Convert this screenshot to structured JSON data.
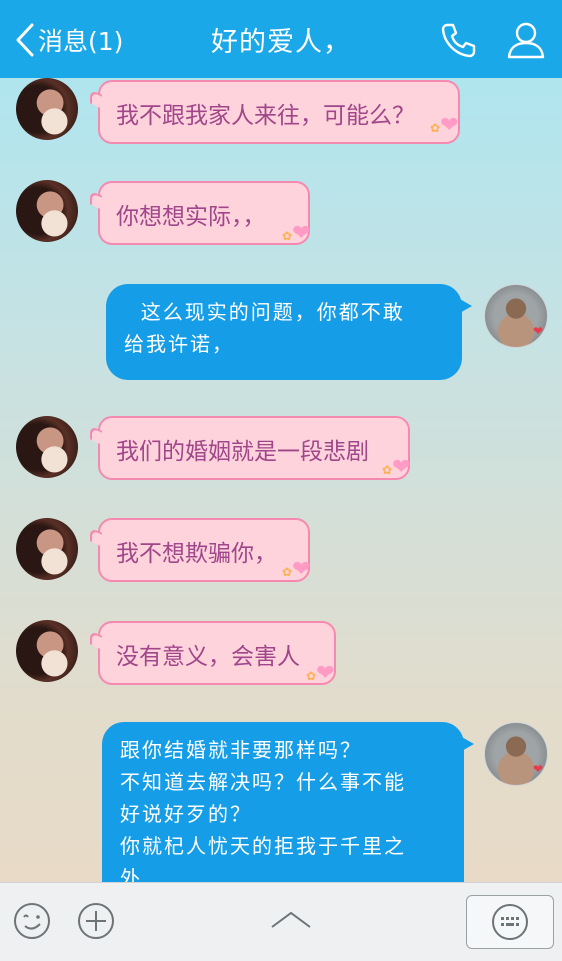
{
  "header": {
    "back_label": "消息(1)",
    "title": "好的爱人，"
  },
  "messages": [
    {
      "side": "left",
      "text": "我不跟我家人来往，可能么？"
    },
    {
      "side": "left",
      "text": "你想想实际，，"
    },
    {
      "side": "right",
      "lines": [
        "  这么现实的问题，你都不敢",
        "给我许诺，"
      ]
    },
    {
      "side": "left",
      "text": "我们的婚姻就是一段悲剧"
    },
    {
      "side": "left",
      "text": "我不想欺骗你，"
    },
    {
      "side": "left",
      "text": "没有意义，会害人"
    },
    {
      "side": "right",
      "lines": [
        "跟你结婚就非要那样吗？",
        "不知道去解决吗？什么事不能",
        "好说好歹的？",
        "你就杞人忧天的拒我于千里之",
        "外"
      ]
    }
  ],
  "icons": {
    "back": "chevron-left-icon",
    "phone": "phone-icon",
    "contact": "contact-icon",
    "emoji": "emoji-icon",
    "plus": "plus-icon",
    "expand": "chevron-up-icon",
    "keyboard": "keyboard-icon"
  },
  "colors": {
    "header": "#1ba8e9",
    "pink_bubble": "#ffd3dc",
    "pink_text": "#a0468a",
    "blue_bubble": "#169de8"
  }
}
